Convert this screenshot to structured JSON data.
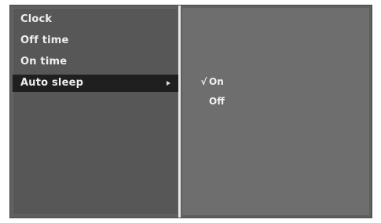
{
  "menu": {
    "items": [
      {
        "label": "Clock"
      },
      {
        "label": "Off time"
      },
      {
        "label": "On time"
      },
      {
        "label": "Auto sleep"
      }
    ]
  },
  "submenu": {
    "options": [
      {
        "label": "On",
        "mark": "√"
      },
      {
        "label": "Off"
      }
    ]
  }
}
